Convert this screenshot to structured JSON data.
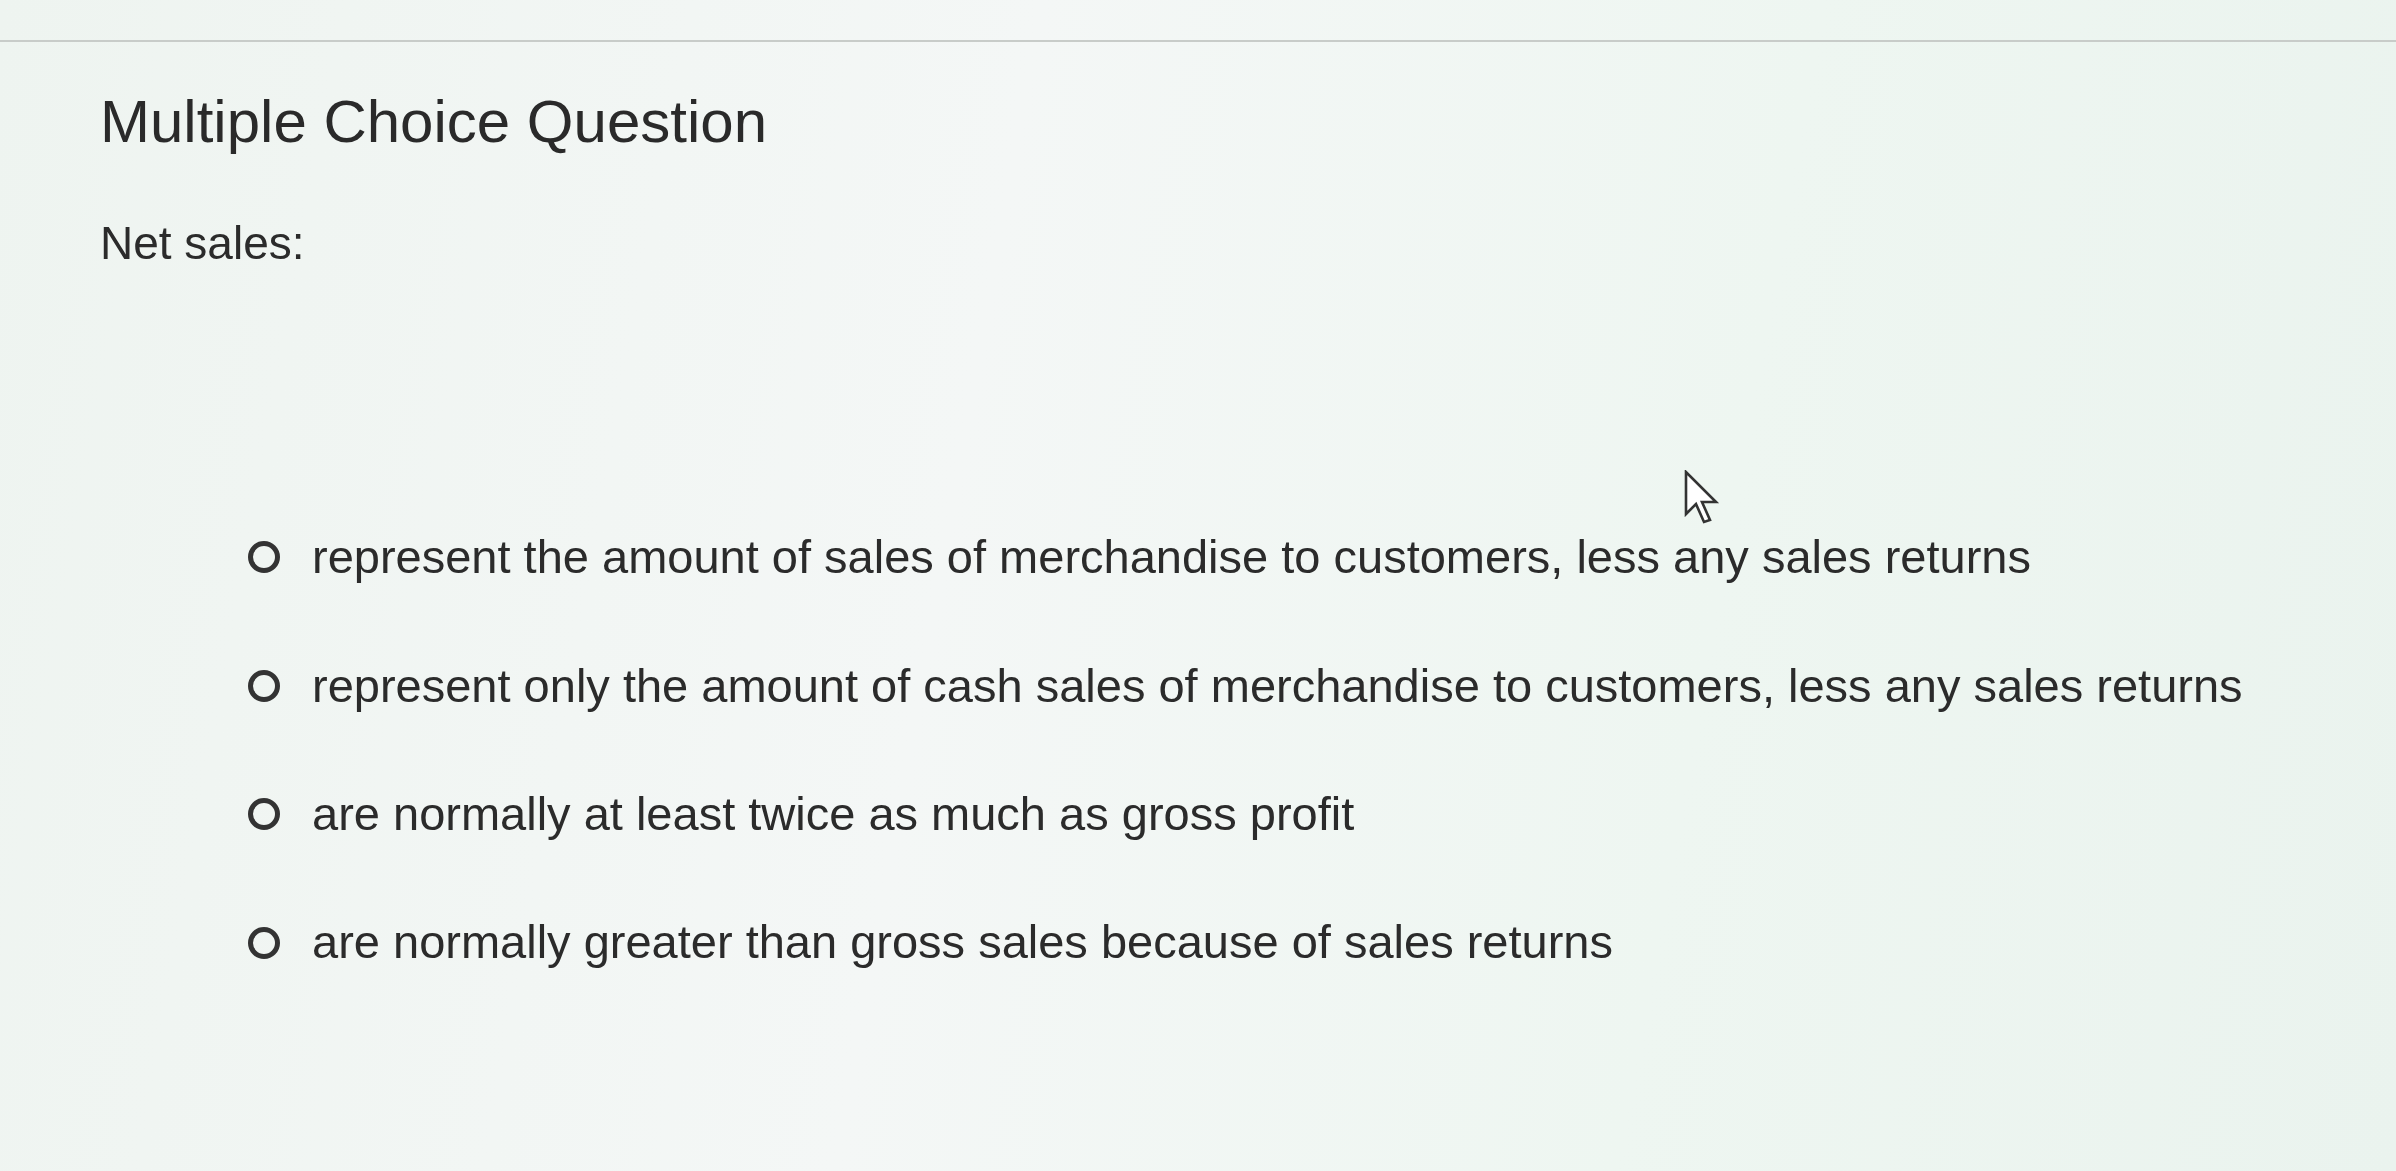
{
  "title": "Multiple Choice Question",
  "question": "Net sales:",
  "options": [
    {
      "label": "represent the amount of sales of merchandise to customers, less any sales returns",
      "selected": false
    },
    {
      "label": "represent only the amount of cash sales of merchandise to customers, less any sales returns",
      "selected": false
    },
    {
      "label": "are normally at least twice as much as gross profit",
      "selected": false
    },
    {
      "label": "are normally greater than gross sales because of sales returns",
      "selected": false
    }
  ]
}
